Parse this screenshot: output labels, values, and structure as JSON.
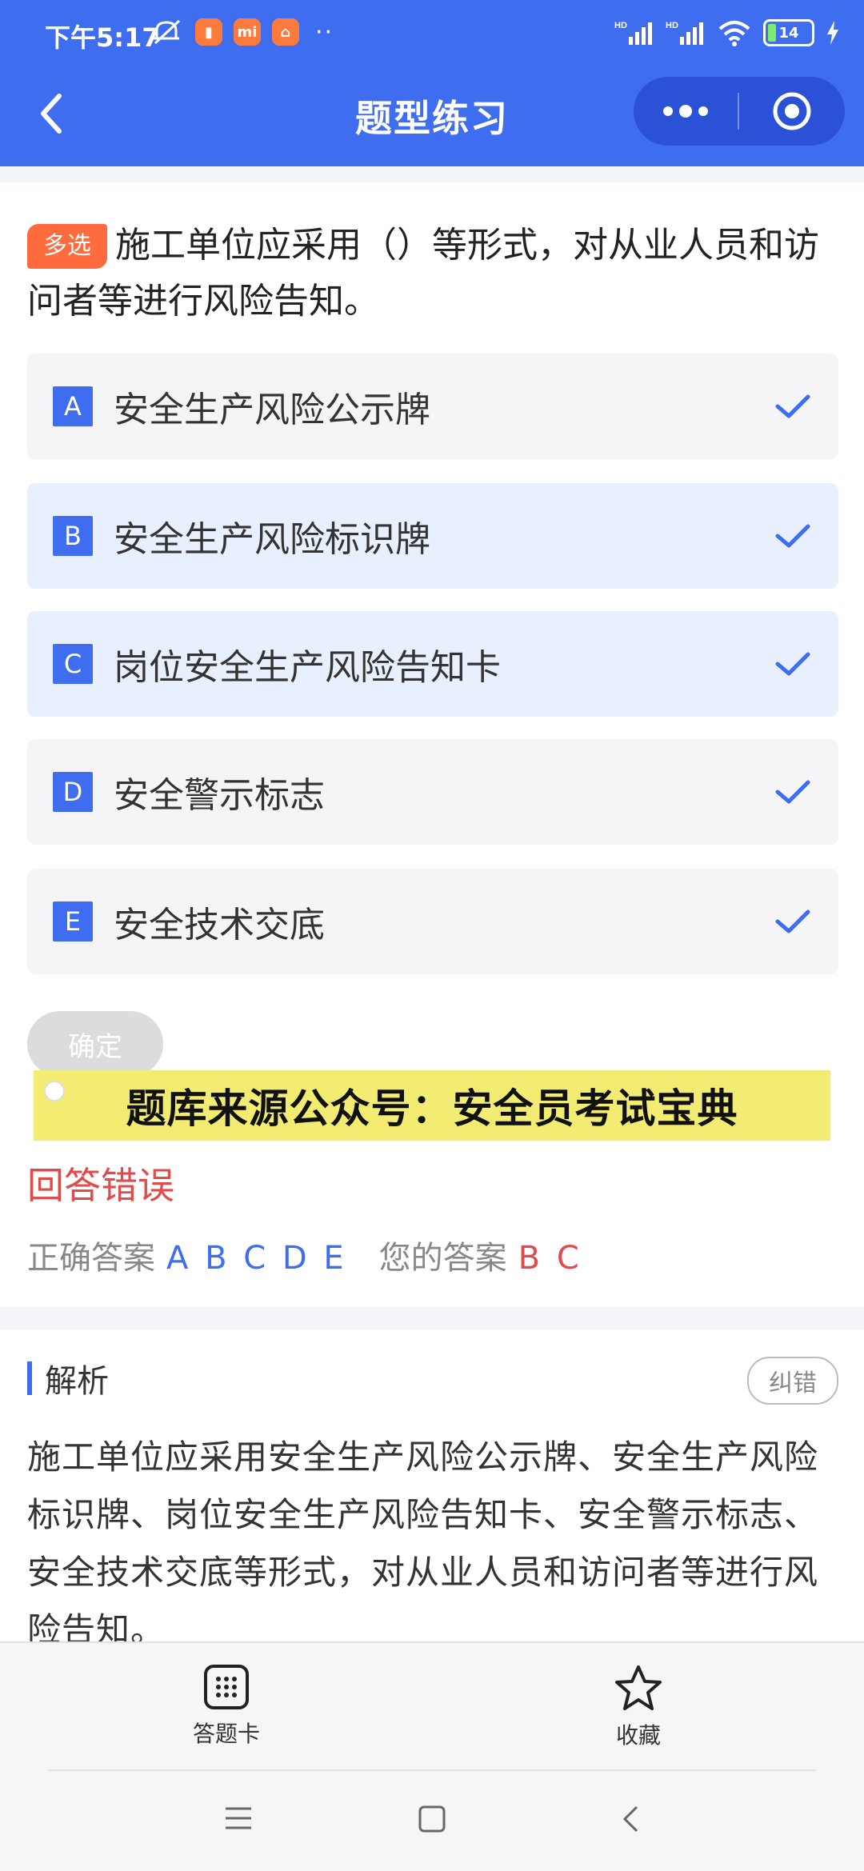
{
  "status_bar": {
    "time": "下午5:17",
    "app_badges": [
      "clipboard",
      "mi",
      "gift"
    ],
    "more": "··",
    "battery": "14"
  },
  "header": {
    "title": "题型练习"
  },
  "question": {
    "type_tag": "多选",
    "text": "施工单位应采用（）等形式，对从业人员和访问者等进行风险告知。",
    "options": [
      {
        "letter": "A",
        "text": "安全生产风险公示牌",
        "selected": false
      },
      {
        "letter": "B",
        "text": "安全生产风险标识牌",
        "selected": true
      },
      {
        "letter": "C",
        "text": "岗位安全生产风险告知卡",
        "selected": true
      },
      {
        "letter": "D",
        "text": "安全警示标志",
        "selected": false
      },
      {
        "letter": "E",
        "text": "安全技术交底",
        "selected": false
      }
    ],
    "confirm_label": "确定"
  },
  "banner": {
    "text": "题库来源公众号：安全员考试宝典"
  },
  "result": {
    "status": "回答错误",
    "correct_label": "正确答案",
    "correct_value": "A B C D E",
    "yours_label": "您的答案",
    "yours_value": "B C"
  },
  "analysis": {
    "title": "解析",
    "report_label": "纠错",
    "text": "施工单位应采用安全生产风险公示牌、安全生产风险标识牌、岗位安全生产风险告知卡、安全警示标志、安全技术交底等形式，对从业人员和访问者等进行风险告知。"
  },
  "bottom_bar": {
    "answer_card_label": "答题卡",
    "favorite_label": "收藏"
  },
  "colors": {
    "primary": "#3f6df0",
    "error": "#e04b4b",
    "tag": "#ff6b3d",
    "banner": "#f3ec72"
  }
}
